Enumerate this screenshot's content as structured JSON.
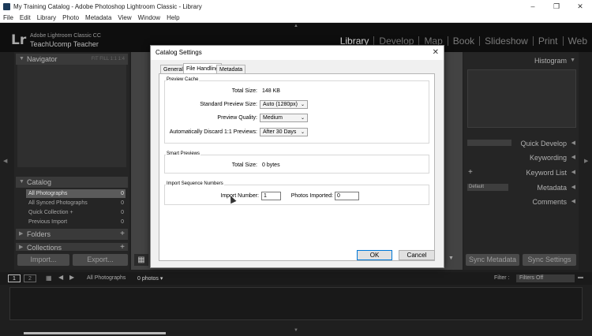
{
  "window": {
    "title": "My Training Catalog - Adobe Photoshop Lightroom Classic - Library",
    "controls": [
      "–",
      "❐",
      "✕"
    ]
  },
  "menu": [
    "File",
    "Edit",
    "Library",
    "Photo",
    "Metadata",
    "View",
    "Window",
    "Help"
  ],
  "identity": {
    "logo": "Lr",
    "product": "Adobe Lightroom Classic CC",
    "owner": "TeachUcomp Teacher"
  },
  "modules": [
    "Library",
    "Develop",
    "Map",
    "Book",
    "Slideshow",
    "Print",
    "Web"
  ],
  "left_panel": {
    "navigator": "Navigator",
    "nav_options": "FIT  FILL  1:1  1:4",
    "catalog": "Catalog",
    "catalog_items": [
      {
        "label": "All Photographs",
        "count": "0"
      },
      {
        "label": "All Synced Photographs",
        "count": "0"
      },
      {
        "label": "Quick Collection +",
        "count": "0"
      },
      {
        "label": "Previous Import",
        "count": "0"
      }
    ],
    "folders": "Folders",
    "collections": "Collections",
    "import_btn": "Import...",
    "export_btn": "Export..."
  },
  "right_panel": {
    "histogram": "Histogram",
    "quick_develop": "Quick Develop",
    "keywording": "Keywording",
    "keyword_list": "Keyword List",
    "metadata_preset": "Default",
    "metadata": "Metadata",
    "comments": "Comments",
    "sync_metadata": "Sync Metadata",
    "sync_settings": "Sync Settings"
  },
  "filmbar": {
    "page1": "1",
    "page2": "2",
    "source": "All Photographs",
    "count": "0 photos",
    "filter_label": "Filter :",
    "filter_value": "Filters Off"
  },
  "dialog": {
    "title": "Catalog Settings",
    "tabs": [
      "General",
      "File Handling",
      "Metadata"
    ],
    "preview_cache": {
      "legend": "Preview Cache",
      "total_size_label": "Total Size:",
      "total_size_value": "148 KB",
      "std_size_label": "Standard Preview Size:",
      "std_size_value": "Auto (1280px)",
      "quality_label": "Preview Quality:",
      "quality_value": "Medium",
      "discard_label": "Automatically Discard 1:1 Previews:",
      "discard_value": "After 30 Days"
    },
    "smart_previews": {
      "legend": "Smart Previews",
      "total_size_label": "Total Size:",
      "total_size_value": "0 bytes"
    },
    "import_seq": {
      "legend": "Import Sequence Numbers",
      "import_number_label": "Import Number:",
      "import_number_value": "1",
      "photos_imported_label": "Photos Imported:",
      "photos_imported_value": "0"
    },
    "ok": "OK",
    "cancel": "Cancel"
  }
}
